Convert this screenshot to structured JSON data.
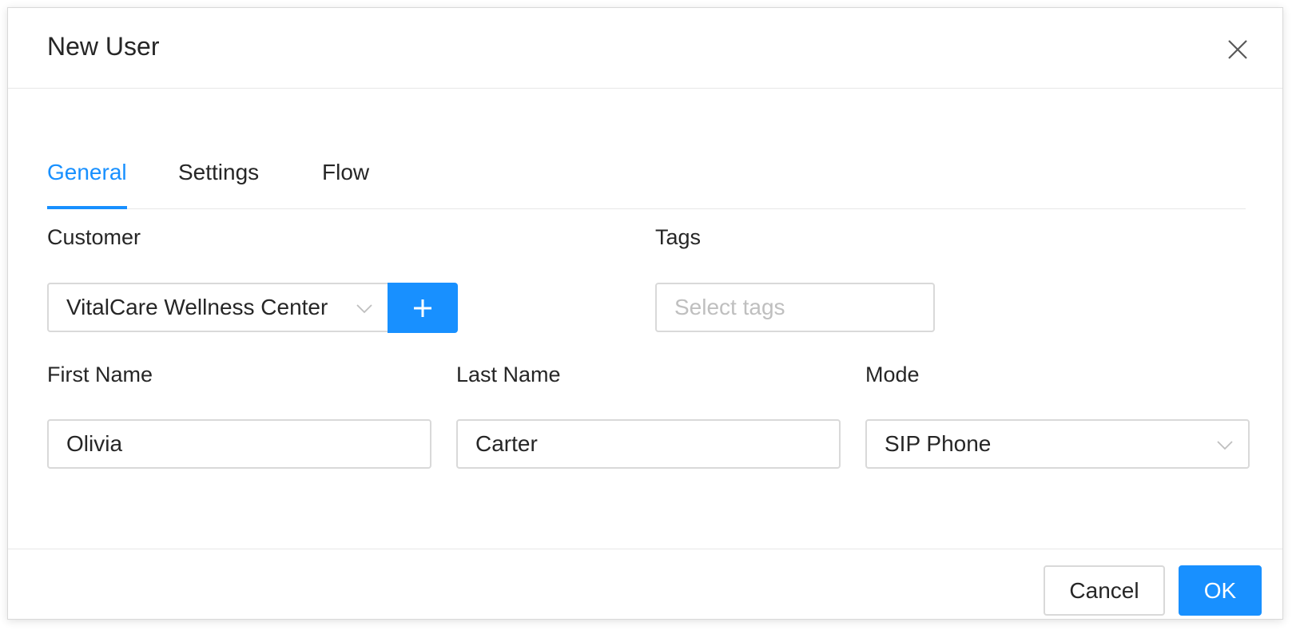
{
  "modal": {
    "title": "New User"
  },
  "tabs": [
    {
      "label": "General",
      "active": true
    },
    {
      "label": "Settings",
      "active": false
    },
    {
      "label": "Flow",
      "active": false
    }
  ],
  "form": {
    "customer": {
      "label": "Customer",
      "value": "VitalCare Wellness Center"
    },
    "tags": {
      "label": "Tags",
      "placeholder": "Select tags"
    },
    "first_name": {
      "label": "First Name",
      "value": "Olivia"
    },
    "last_name": {
      "label": "Last Name",
      "value": "Carter"
    },
    "mode": {
      "label": "Mode",
      "value": "SIP Phone"
    }
  },
  "footer": {
    "cancel_label": "Cancel",
    "ok_label": "OK"
  },
  "icons": {
    "close": "close-icon",
    "add": "plus-icon",
    "dropdown": "chevron-down-icon"
  },
  "colors": {
    "accent": "#1890ff",
    "border": "#d9d9d9",
    "text": "#262626",
    "placeholder": "#bfbfbf"
  }
}
